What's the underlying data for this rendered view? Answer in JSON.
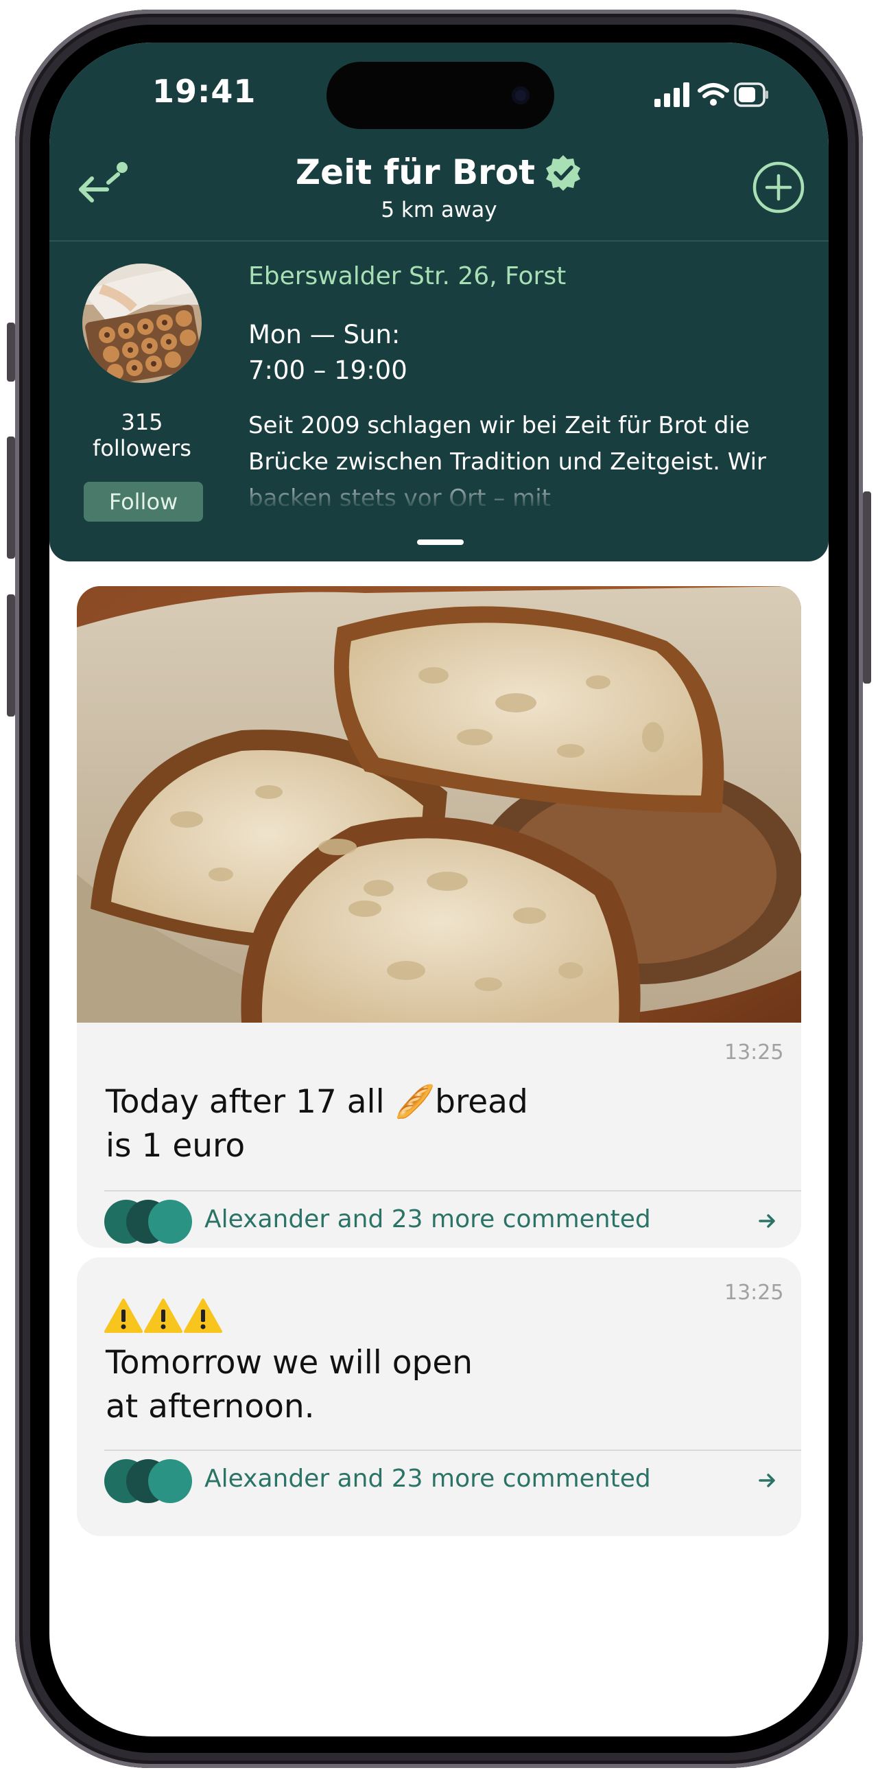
{
  "status_bar": {
    "time": "19:41"
  },
  "header": {
    "title": "Zeit für Brot",
    "distance": "5 km away",
    "icons": {
      "back": "arrow-left-icon",
      "verified": "verified-badge-icon",
      "add": "plus-circle-icon"
    }
  },
  "profile": {
    "address": "Eberswalder Str. 26, Forst",
    "hours_label": "Mon — Sun:",
    "hours_value": "7:00 – 19:00",
    "description": "Seit 2009 schlagen wir bei Zeit für Brot die Brücke zwischen Tradition und Zeitgeist. Wir backen stets vor Ort – mit",
    "followers_count": "315",
    "followers_label": "followers",
    "follow_label": "Follow"
  },
  "posts": [
    {
      "time": "13:25",
      "text_line1": "Today after 17 all 🥖bread",
      "text_line2": "is 1 euro",
      "comments": "Alexander and 23 more commented"
    },
    {
      "time": "13:25",
      "emoji_row": "⚠️⚠️⚠️",
      "text_line1": "Tomorrow we will open",
      "text_line2": "at afternoon.",
      "comments": "Alexander and 23 more commented"
    }
  ],
  "colors": {
    "header_bg": "#183e3f",
    "accent_green": "#a8dfb4",
    "comment_teal": "#2b7366",
    "card_bg": "#f3f3f3"
  }
}
